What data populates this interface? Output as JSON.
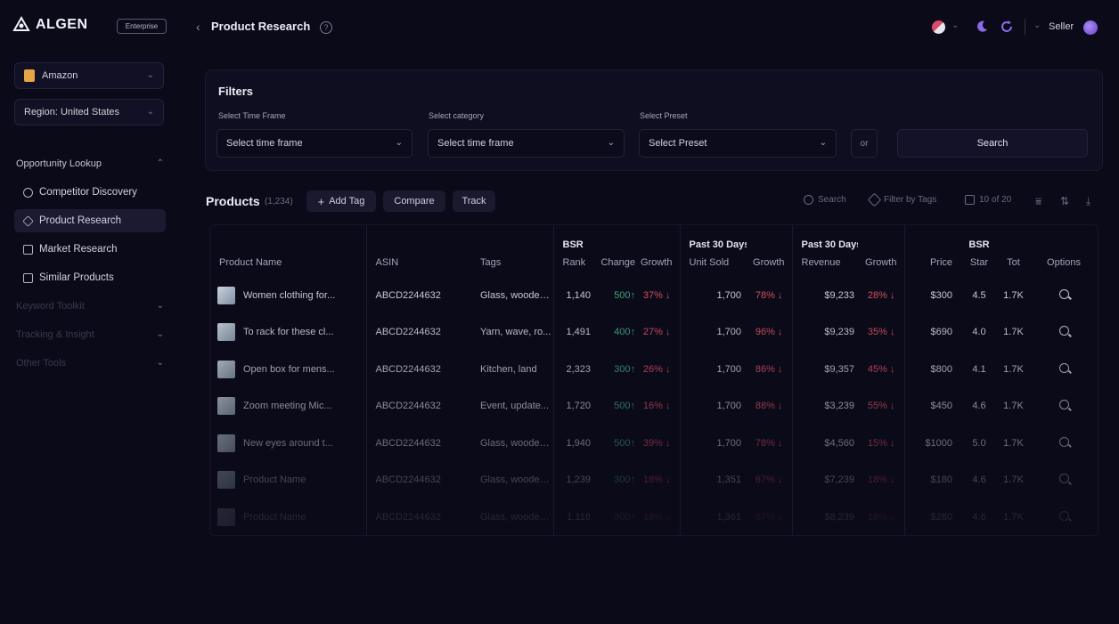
{
  "header": {
    "logo_text": "ALGEN",
    "plan_badge": "Enterprise",
    "page_title": "Product Research",
    "user_name": "Seller"
  },
  "sidebar": {
    "marketplace": "Amazon",
    "region": "Region: United States",
    "section_opportunity": "Opportunity Lookup",
    "items": [
      {
        "label": "Competitor Discovery",
        "icon": "search-icon"
      },
      {
        "label": "Product Research",
        "icon": "diamond-icon"
      },
      {
        "label": "Market Research",
        "icon": "calendar-icon"
      },
      {
        "label": "Similar Products",
        "icon": "grid-icon"
      }
    ],
    "section_keyword": "Keyword Toolkit",
    "section_tracking": "Tracking & Insight",
    "section_other": "Other Tools"
  },
  "filters": {
    "title": "Filters",
    "time_frame_label": "Select Time Frame",
    "time_frame_placeholder": "Select time frame",
    "category_label": "Select category",
    "category_placeholder": "Select time frame",
    "preset_label": "Select Preset",
    "preset_placeholder": "Select Preset",
    "or_text": "or",
    "search_button": "Search"
  },
  "products": {
    "title": "Products",
    "count": "(1,234)",
    "add_tag": "Add Tag",
    "compare": "Compare",
    "track": "Track",
    "search": "Search",
    "filter_by_tags": "Filter by Tags",
    "columns_count": "10 of 20"
  },
  "table": {
    "group_bsr": "BSR",
    "group_past30_units": "Past 30 Days",
    "group_past30_revenue": "Past 30 Days",
    "group_bsr_star": "BSR",
    "headers": {
      "product_name": "Product Name",
      "asin": "ASIN",
      "tags": "Tags",
      "rank": "Rank",
      "change": "Change",
      "growth": "Growth",
      "unit_sold": "Unit Sold",
      "unit_growth": "Growth",
      "revenue": "Revenue",
      "rev_growth": "Growth",
      "price": "Price",
      "star": "Star",
      "tot": "Tot",
      "options": "Options"
    },
    "rows": [
      {
        "name": "Women clothing for...",
        "asin": "ABCD2244632",
        "tags": "Glass, wooden...",
        "rank": "1,140",
        "change": "500↑",
        "growth": "37% ↓",
        "units": "1,700",
        "unit_growth": "78% ↓",
        "revenue": "$9,233",
        "rev_growth": "28% ↓",
        "price": "$300",
        "star": "4.5",
        "tot": "1.7K"
      },
      {
        "name": "To rack for these cl...",
        "asin": "ABCD2244632",
        "tags": "Yarn, wave, ro...",
        "rank": "1,491",
        "change": "400↑",
        "growth": "27% ↓",
        "units": "1,700",
        "unit_growth": "96% ↓",
        "revenue": "$9,239",
        "rev_growth": "35% ↓",
        "price": "$690",
        "star": "4.0",
        "tot": "1.7K"
      },
      {
        "name": "Open box for mens...",
        "asin": "ABCD2244632",
        "tags": "Kitchen, land",
        "rank": "2,323",
        "change": "300↑",
        "growth": "26% ↓",
        "units": "1,700",
        "unit_growth": "86% ↓",
        "revenue": "$9,357",
        "rev_growth": "45% ↓",
        "price": "$800",
        "star": "4.1",
        "tot": "1.7K"
      },
      {
        "name": "Zoom meeting Mic...",
        "asin": "ABCD2244632",
        "tags": "Event, update...",
        "rank": "1,720",
        "change": "500↑",
        "growth": "16% ↓",
        "units": "1,700",
        "unit_growth": "88% ↓",
        "revenue": "$3,239",
        "rev_growth": "55% ↓",
        "price": "$450",
        "star": "4.6",
        "tot": "1.7K"
      },
      {
        "name": "New eyes around t...",
        "asin": "ABCD2244632",
        "tags": "Glass, wooden...",
        "rank": "1,940",
        "change": "500↑",
        "growth": "39% ↓",
        "units": "1,700",
        "unit_growth": "78% ↓",
        "revenue": "$4,560",
        "rev_growth": "15% ↓",
        "price": "$1000",
        "star": "5.0",
        "tot": "1.7K"
      },
      {
        "name": "Product Name",
        "asin": "ABCD2244632",
        "tags": "Glass, wooden...",
        "rank": "1,239",
        "change": "300↑",
        "growth": "18% ↓",
        "units": "1,351",
        "unit_growth": "67% ↓",
        "revenue": "$7,239",
        "rev_growth": "18% ↓",
        "price": "$180",
        "star": "4.6",
        "tot": "1.7K"
      },
      {
        "name": "Product Name",
        "asin": "ABCD2244632",
        "tags": "Glass, wooden...",
        "rank": "1,118",
        "change": "300↑",
        "growth": "18% ↓",
        "units": "1,361",
        "unit_growth": "67% ↓",
        "revenue": "$8,239",
        "rev_growth": "18% ↓",
        "price": "$280",
        "star": "4.6",
        "tot": "1.7K"
      }
    ]
  },
  "colors": {
    "background": "#0b0a19",
    "positive": "#3ea37b",
    "negative": "#d2505d",
    "accent": "#8a6ae8"
  }
}
